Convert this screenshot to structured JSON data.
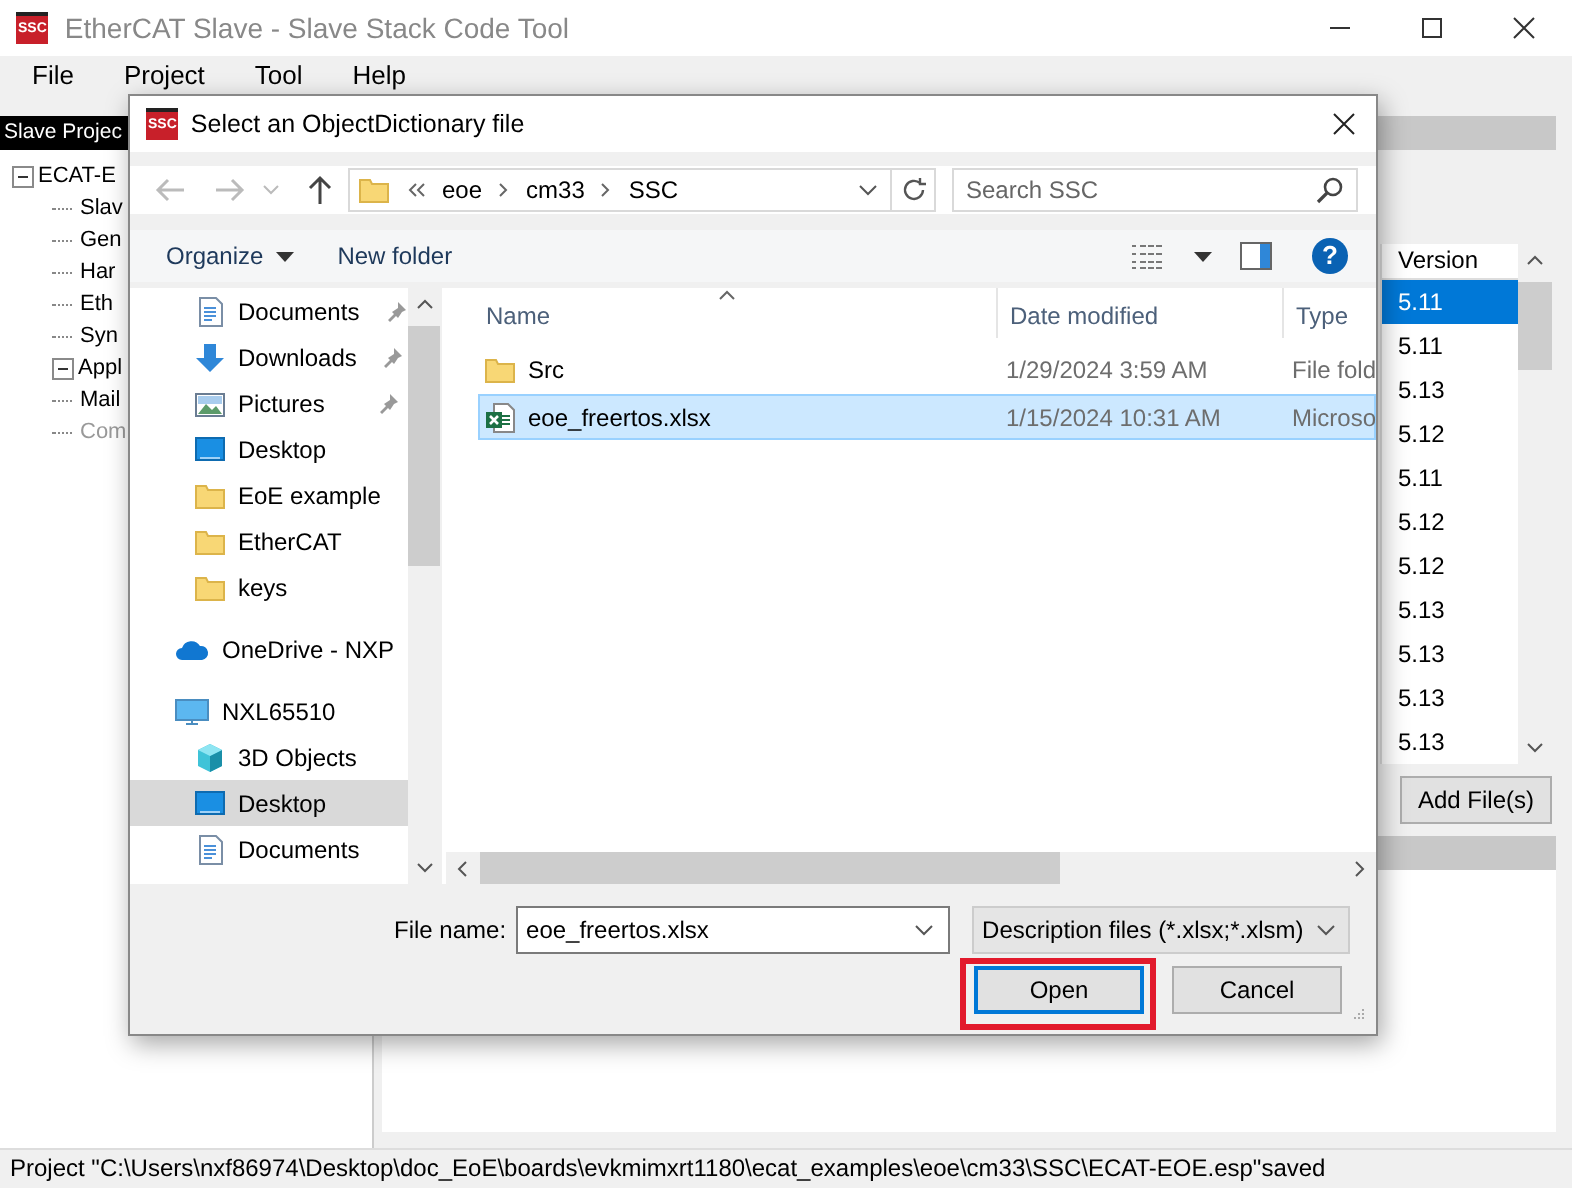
{
  "window": {
    "logo_text": "SSC",
    "title": "EtherCAT Slave - Slave Stack Code Tool"
  },
  "menu": [
    "File",
    "Project",
    "Tool",
    "Help"
  ],
  "project_panel": {
    "title": "Slave Projec",
    "tree": [
      {
        "label": "ECAT-E",
        "expanded": true,
        "disabled": false,
        "children": [
          {
            "label": "Slav",
            "disabled": false
          },
          {
            "label": "Gen",
            "disabled": false
          },
          {
            "label": "Har",
            "disabled": false
          },
          {
            "label": "Eth",
            "disabled": false
          },
          {
            "label": "Syn",
            "disabled": false
          },
          {
            "label": "Appl",
            "expanded": true,
            "disabled": false
          },
          {
            "label": "Mail",
            "disabled": false
          },
          {
            "label": "Com",
            "disabled": true
          }
        ]
      }
    ]
  },
  "version_table": {
    "column": "Version",
    "rows": [
      {
        "version": "5.11",
        "selected": true
      },
      {
        "version": "5.11",
        "selected": false
      },
      {
        "version": "5.13",
        "selected": false
      },
      {
        "version": "5.12",
        "selected": false
      },
      {
        "version": "5.11",
        "selected": false
      },
      {
        "version": "5.12",
        "selected": false
      },
      {
        "version": "5.12",
        "selected": false
      },
      {
        "version": "5.13",
        "selected": false
      },
      {
        "version": "5.13",
        "selected": false
      },
      {
        "version": "5.13",
        "selected": false
      },
      {
        "version": "5.13",
        "selected": false
      }
    ]
  },
  "add_files_button": "Add File(s)",
  "status_bar": "Project \"C:\\Users\\nxf86974\\Desktop\\doc_EoE\\boards\\evkmimxrt1180\\ecat_examples\\eoe\\cm33\\SSC\\ECAT-EOE.esp\"saved",
  "dialog": {
    "logo_text": "SSC",
    "title": "Select an ObjectDictionary file",
    "path": [
      "eoe",
      "cm33",
      "SSC"
    ],
    "search": {
      "placeholder": "Search SSC"
    },
    "toolbar": [
      "Organize",
      "New folder"
    ],
    "help": "?",
    "nav": {
      "quick_access": [
        {
          "label": "Documents",
          "kind": "documents",
          "pinned": true,
          "selected": false
        },
        {
          "label": "Downloads",
          "kind": "downloads",
          "pinned": true,
          "selected": false
        },
        {
          "label": "Pictures",
          "kind": "pictures",
          "pinned": true,
          "selected": false
        },
        {
          "label": "Desktop",
          "kind": "desktop",
          "pinned": false,
          "selected": false
        },
        {
          "label": "EoE example",
          "kind": "folder",
          "pinned": false,
          "selected": false
        },
        {
          "label": "EtherCAT",
          "kind": "folder",
          "pinned": false,
          "selected": false
        },
        {
          "label": "keys",
          "kind": "folder",
          "pinned": false,
          "selected": false
        }
      ],
      "locations": [
        {
          "label": "OneDrive - NXP",
          "kind": "cloud",
          "selected": false
        },
        {
          "label": "NXL65510",
          "kind": "computer",
          "selected": false,
          "children": [
            {
              "label": "3D Objects",
              "kind": "cube",
              "selected": false
            },
            {
              "label": "Desktop",
              "kind": "desktop",
              "selected": true
            },
            {
              "label": "Documents",
              "kind": "documents",
              "selected": false
            }
          ]
        }
      ]
    },
    "columns": [
      "Name",
      "Date modified",
      "Type"
    ],
    "files": [
      {
        "kind": "folder",
        "name": "Src",
        "date": "1/29/2024 3:59 AM",
        "type": "File fold",
        "selected": false
      },
      {
        "kind": "spreadsheet",
        "name": "eoe_freertos.xlsx",
        "date": "1/15/2024 10:31 AM",
        "type": "Microso",
        "selected": true
      }
    ],
    "file_name_label": "File name:",
    "file_name": "eoe_freertos.xlsx",
    "filter": "Description files (*.xlsx;*.xlsm)",
    "buttons": [
      {
        "label": "Open",
        "default": true,
        "highlighted": true
      },
      {
        "label": "Cancel",
        "default": false,
        "highlighted": false
      }
    ]
  }
}
